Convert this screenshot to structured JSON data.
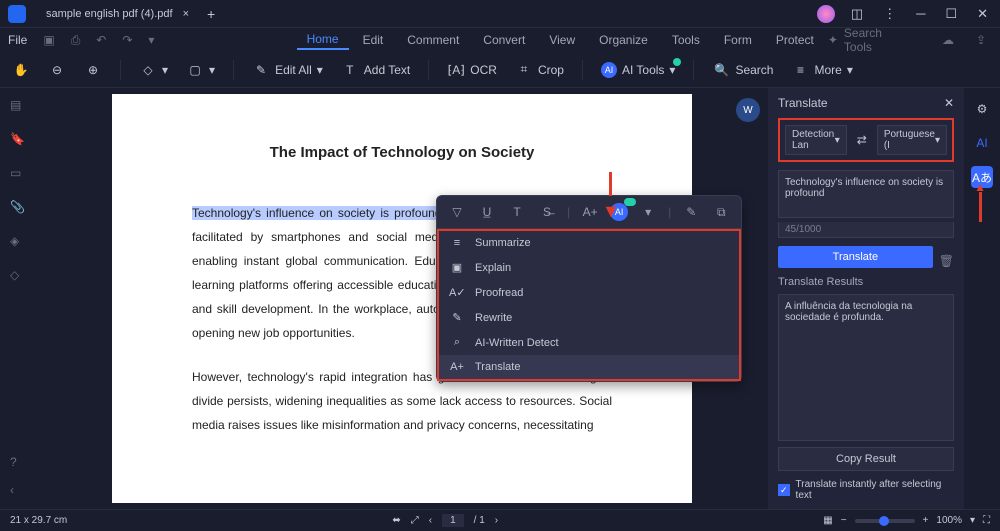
{
  "titlebar": {
    "tab_name": "sample english pdf (4).pdf"
  },
  "menubar": {
    "file": "File",
    "items": [
      "Home",
      "Edit",
      "Comment",
      "Convert",
      "View",
      "Organize",
      "Tools",
      "Form",
      "Protect"
    ],
    "search_placeholder": "Search Tools"
  },
  "toolbar": {
    "edit_all": "Edit All",
    "add_text": "Add Text",
    "ocr": "OCR",
    "crop": "Crop",
    "ai_tools": "AI Tools",
    "search": "Search",
    "more": "More"
  },
  "document": {
    "title": "The Impact of Technology on Society",
    "highlighted": "Technology's influence on society is profound",
    "para1_rest": ", work, and learn. Connectivity, facilitated by smartphones and social media, bridges geographical gaps, enabling instant global communication. Education has transformed, with e-learning platforms offering accessible education, empowering remote learning and skill development. In the workplace, automation and AI streamline tasks, opening new job opportunities.",
    "para2": "However, technology's rapid integration has generated concerns. The digital divide persists, widening inequalities as some lack access to resources. Social media raises issues like misinformation and privacy concerns, necessitating"
  },
  "context": {
    "items": [
      "Summarize",
      "Explain",
      "Proofread",
      "Rewrite",
      "AI-Written Detect",
      "Translate"
    ]
  },
  "translate": {
    "header": "Translate",
    "source_lang": "Detection Lan",
    "target_lang": "Portuguese (I",
    "input_text": "Technology's influence on society is profound",
    "counter": "45/1000",
    "button": "Translate",
    "results_label": "Translate Results",
    "result_text": "A influência da tecnologia na sociedade é profunda.",
    "copy": "Copy Result",
    "checkbox_label": "Translate instantly after selecting text"
  },
  "statusbar": {
    "dimensions": "21 x 29.7 cm",
    "page": "1",
    "total": "/ 1",
    "zoom": "100%"
  }
}
